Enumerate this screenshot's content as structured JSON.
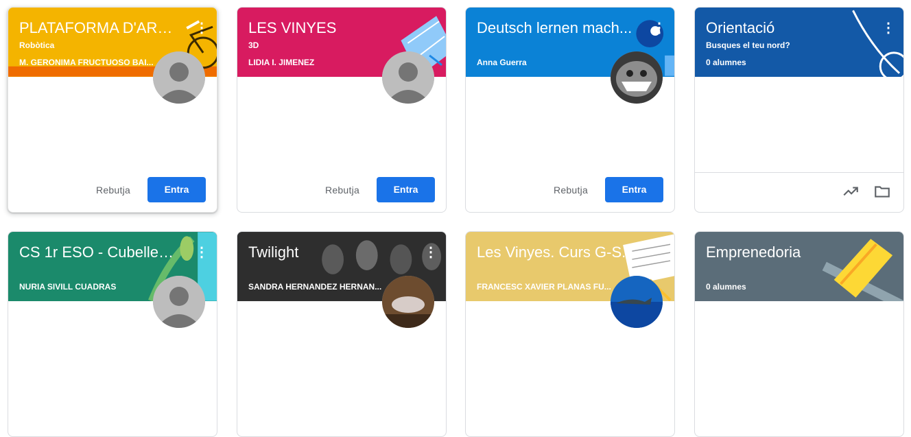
{
  "classes": [
    {
      "title": "PLATAFORMA D'ARD...",
      "subtitle": "Robòtica",
      "teacher": "M. GERONIMA FRUCTUOSO BAI...",
      "actions": {
        "decline": "Rebutja",
        "join": "Entra"
      }
    },
    {
      "title": "LES VINYES",
      "subtitle": "3D",
      "teacher": "LIDIA I. JIMENEZ",
      "actions": {
        "decline": "Rebutja",
        "join": "Entra"
      }
    },
    {
      "title": "Deutsch lernen mach...",
      "teacher": "Anna Guerra",
      "actions": {
        "decline": "Rebutja",
        "join": "Entra"
      }
    },
    {
      "title": "Orientació",
      "subtitle": "Busques el teu nord?",
      "teacher": "0 alumnes",
      "footer_icons": [
        "trending-up-icon",
        "folder-icon"
      ]
    },
    {
      "title": "CS 1r ESO - Cubelles,...",
      "teacher": "NURIA SIVILL CUADRAS"
    },
    {
      "title": "Twilight",
      "teacher": "SANDRA HERNANDEZ HERNAN..."
    },
    {
      "title": "Les Vinyes. Curs G-S...",
      "teacher": "FRANCESC XAVIER PLANAS FU..."
    },
    {
      "title": "Emprenedoria",
      "teacher": "0 alumnes"
    }
  ],
  "colors": {
    "robotics": "#f4b400",
    "pink": "#d81b60",
    "blue": "#0b82d6",
    "navy": "#1359a7",
    "teal": "#1b8a6b",
    "dark": "#3b3b3b",
    "sand": "#e8c96c",
    "slate": "#5b6d79",
    "button": "#1a73e8"
  }
}
